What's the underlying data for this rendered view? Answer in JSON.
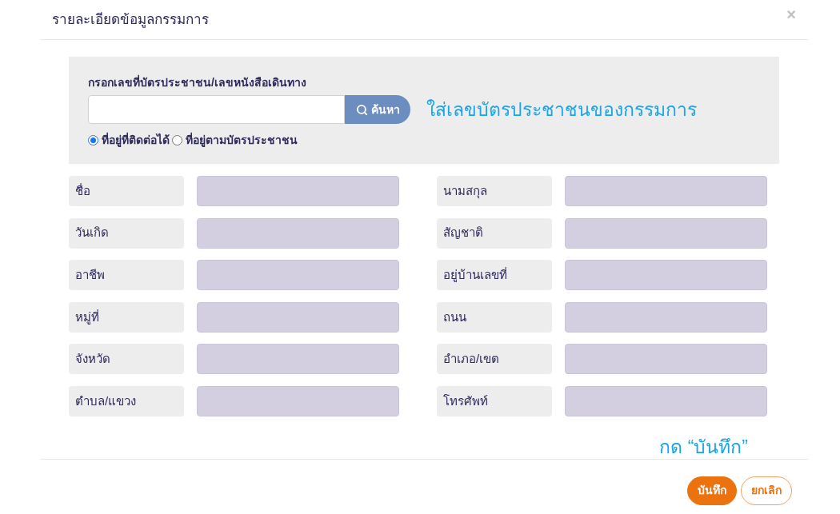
{
  "dialog": {
    "title": "รายละเอียดข้อมูลกรรมการ",
    "close": "×"
  },
  "search": {
    "label": "กรอกเลขที่บัตรประชาชน/เลขหนังสือเดินทาง",
    "button": "ค้นหา",
    "hint": "ใส่เลขบัตรประชาชนของกรรมการ",
    "radios": [
      {
        "label": "ที่อยู่ที่ติดต่อได้",
        "selected": true
      },
      {
        "label": "ที่อยู่ตามบัตรประชาชน",
        "selected": false
      }
    ]
  },
  "fields": [
    {
      "label": "ชื่อ"
    },
    {
      "label": "นามสกุล"
    },
    {
      "label": "วันเกิด"
    },
    {
      "label": "สัญชาติ"
    },
    {
      "label": "อาชีพ"
    },
    {
      "label": "อยู่บ้านเลขที่"
    },
    {
      "label": "หมู่ที่"
    },
    {
      "label": "ถนน"
    },
    {
      "label": "จังหวัด"
    },
    {
      "label": "อำเภอ/เขต"
    },
    {
      "label": "ตำบล/แขวง"
    },
    {
      "label": "โทรศัพท์"
    }
  ],
  "footer": {
    "hint": "กด “บันทึก”",
    "buttons": [
      {
        "label": "บันทึก",
        "kind": "primary"
      },
      {
        "label": "ยกเลิก",
        "kind": "secondary"
      }
    ]
  }
}
